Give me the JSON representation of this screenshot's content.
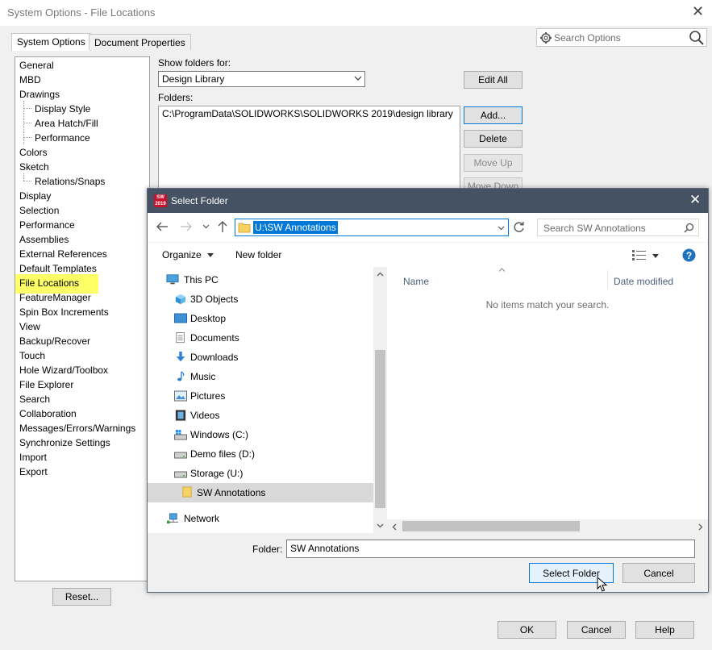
{
  "window": {
    "title": "System Options - File Locations",
    "close_glyph": "✕",
    "tabs": [
      "System Options",
      "Document Properties"
    ],
    "search_placeholder": "Search Options"
  },
  "options_tree": [
    {
      "label": "General",
      "level": 0
    },
    {
      "label": "MBD",
      "level": 0
    },
    {
      "label": "Drawings",
      "level": 0
    },
    {
      "label": "Display Style",
      "level": 1
    },
    {
      "label": "Area Hatch/Fill",
      "level": 1
    },
    {
      "label": "Performance",
      "level": 1
    },
    {
      "label": "Colors",
      "level": 0
    },
    {
      "label": "Sketch",
      "level": 0
    },
    {
      "label": "Relations/Snaps",
      "level": 1
    },
    {
      "label": "Display",
      "level": 0
    },
    {
      "label": "Selection",
      "level": 0
    },
    {
      "label": "Performance",
      "level": 0
    },
    {
      "label": "Assemblies",
      "level": 0
    },
    {
      "label": "External References",
      "level": 0
    },
    {
      "label": "Default Templates",
      "level": 0
    },
    {
      "label": "File Locations",
      "level": 0,
      "selected": true
    },
    {
      "label": "FeatureManager",
      "level": 0
    },
    {
      "label": "Spin Box Increments",
      "level": 0
    },
    {
      "label": "View",
      "level": 0
    },
    {
      "label": "Backup/Recover",
      "level": 0
    },
    {
      "label": "Touch",
      "level": 0
    },
    {
      "label": "Hole Wizard/Toolbox",
      "level": 0
    },
    {
      "label": "File Explorer",
      "level": 0
    },
    {
      "label": "Search",
      "level": 0
    },
    {
      "label": "Collaboration",
      "level": 0
    },
    {
      "label": "Messages/Errors/Warnings",
      "level": 0
    },
    {
      "label": "Synchronize Settings",
      "level": 0
    },
    {
      "label": "Import",
      "level": 0
    },
    {
      "label": "Export",
      "level": 0
    }
  ],
  "file_locations": {
    "show_folders_label": "Show folders for:",
    "show_folders_value": "Design Library",
    "folders_label": "Folders:",
    "folders": [
      "C:\\ProgramData\\SOLIDWORKS\\SOLIDWORKS 2019\\design library"
    ],
    "buttons": {
      "edit_all": "Edit All",
      "add": "Add...",
      "delete": "Delete",
      "move_up": "Move Up",
      "move_down": "Move Down"
    }
  },
  "footer": {
    "reset": "Reset...",
    "ok": "OK",
    "cancel": "Cancel",
    "help": "Help"
  },
  "dialog": {
    "title": "Select Folder",
    "icon_text": "SW 2019",
    "address": "U:\\SW Annotations",
    "search_placeholder": "Search SW Annotations",
    "organize": "Organize",
    "new_folder": "New folder",
    "nav_items": [
      {
        "label": "This PC",
        "icon": "computer-icon",
        "indent": 0
      },
      {
        "label": "3D Objects",
        "icon": "cube-icon",
        "indent": 1
      },
      {
        "label": "Desktop",
        "icon": "desktop-icon",
        "indent": 1
      },
      {
        "label": "Documents",
        "icon": "document-icon",
        "indent": 1
      },
      {
        "label": "Downloads",
        "icon": "download-icon",
        "indent": 1
      },
      {
        "label": "Music",
        "icon": "music-icon",
        "indent": 1
      },
      {
        "label": "Pictures",
        "icon": "pictures-icon",
        "indent": 1
      },
      {
        "label": "Videos",
        "icon": "videos-icon",
        "indent": 1
      },
      {
        "label": "Windows (C:)",
        "icon": "drive-windows-icon",
        "indent": 1
      },
      {
        "label": "Demo files (D:)",
        "icon": "drive-icon",
        "indent": 1
      },
      {
        "label": "Storage (U:)",
        "icon": "drive-icon",
        "indent": 1
      },
      {
        "label": "SW Annotations",
        "icon": "folder-icon",
        "indent": 2,
        "selected": true
      },
      {
        "label": "Network",
        "icon": "network-icon",
        "indent": 0
      }
    ],
    "columns": {
      "name": "Name",
      "date_modified": "Date modified"
    },
    "empty_message": "No items match your search.",
    "folder_label": "Folder:",
    "folder_value": "SW Annotations",
    "select_folder": "Select Folder",
    "cancel": "Cancel"
  },
  "colors": {
    "dialog_titlebar": "#445263",
    "selection_highlight": "#ffff66",
    "accent": "#0078d7"
  }
}
